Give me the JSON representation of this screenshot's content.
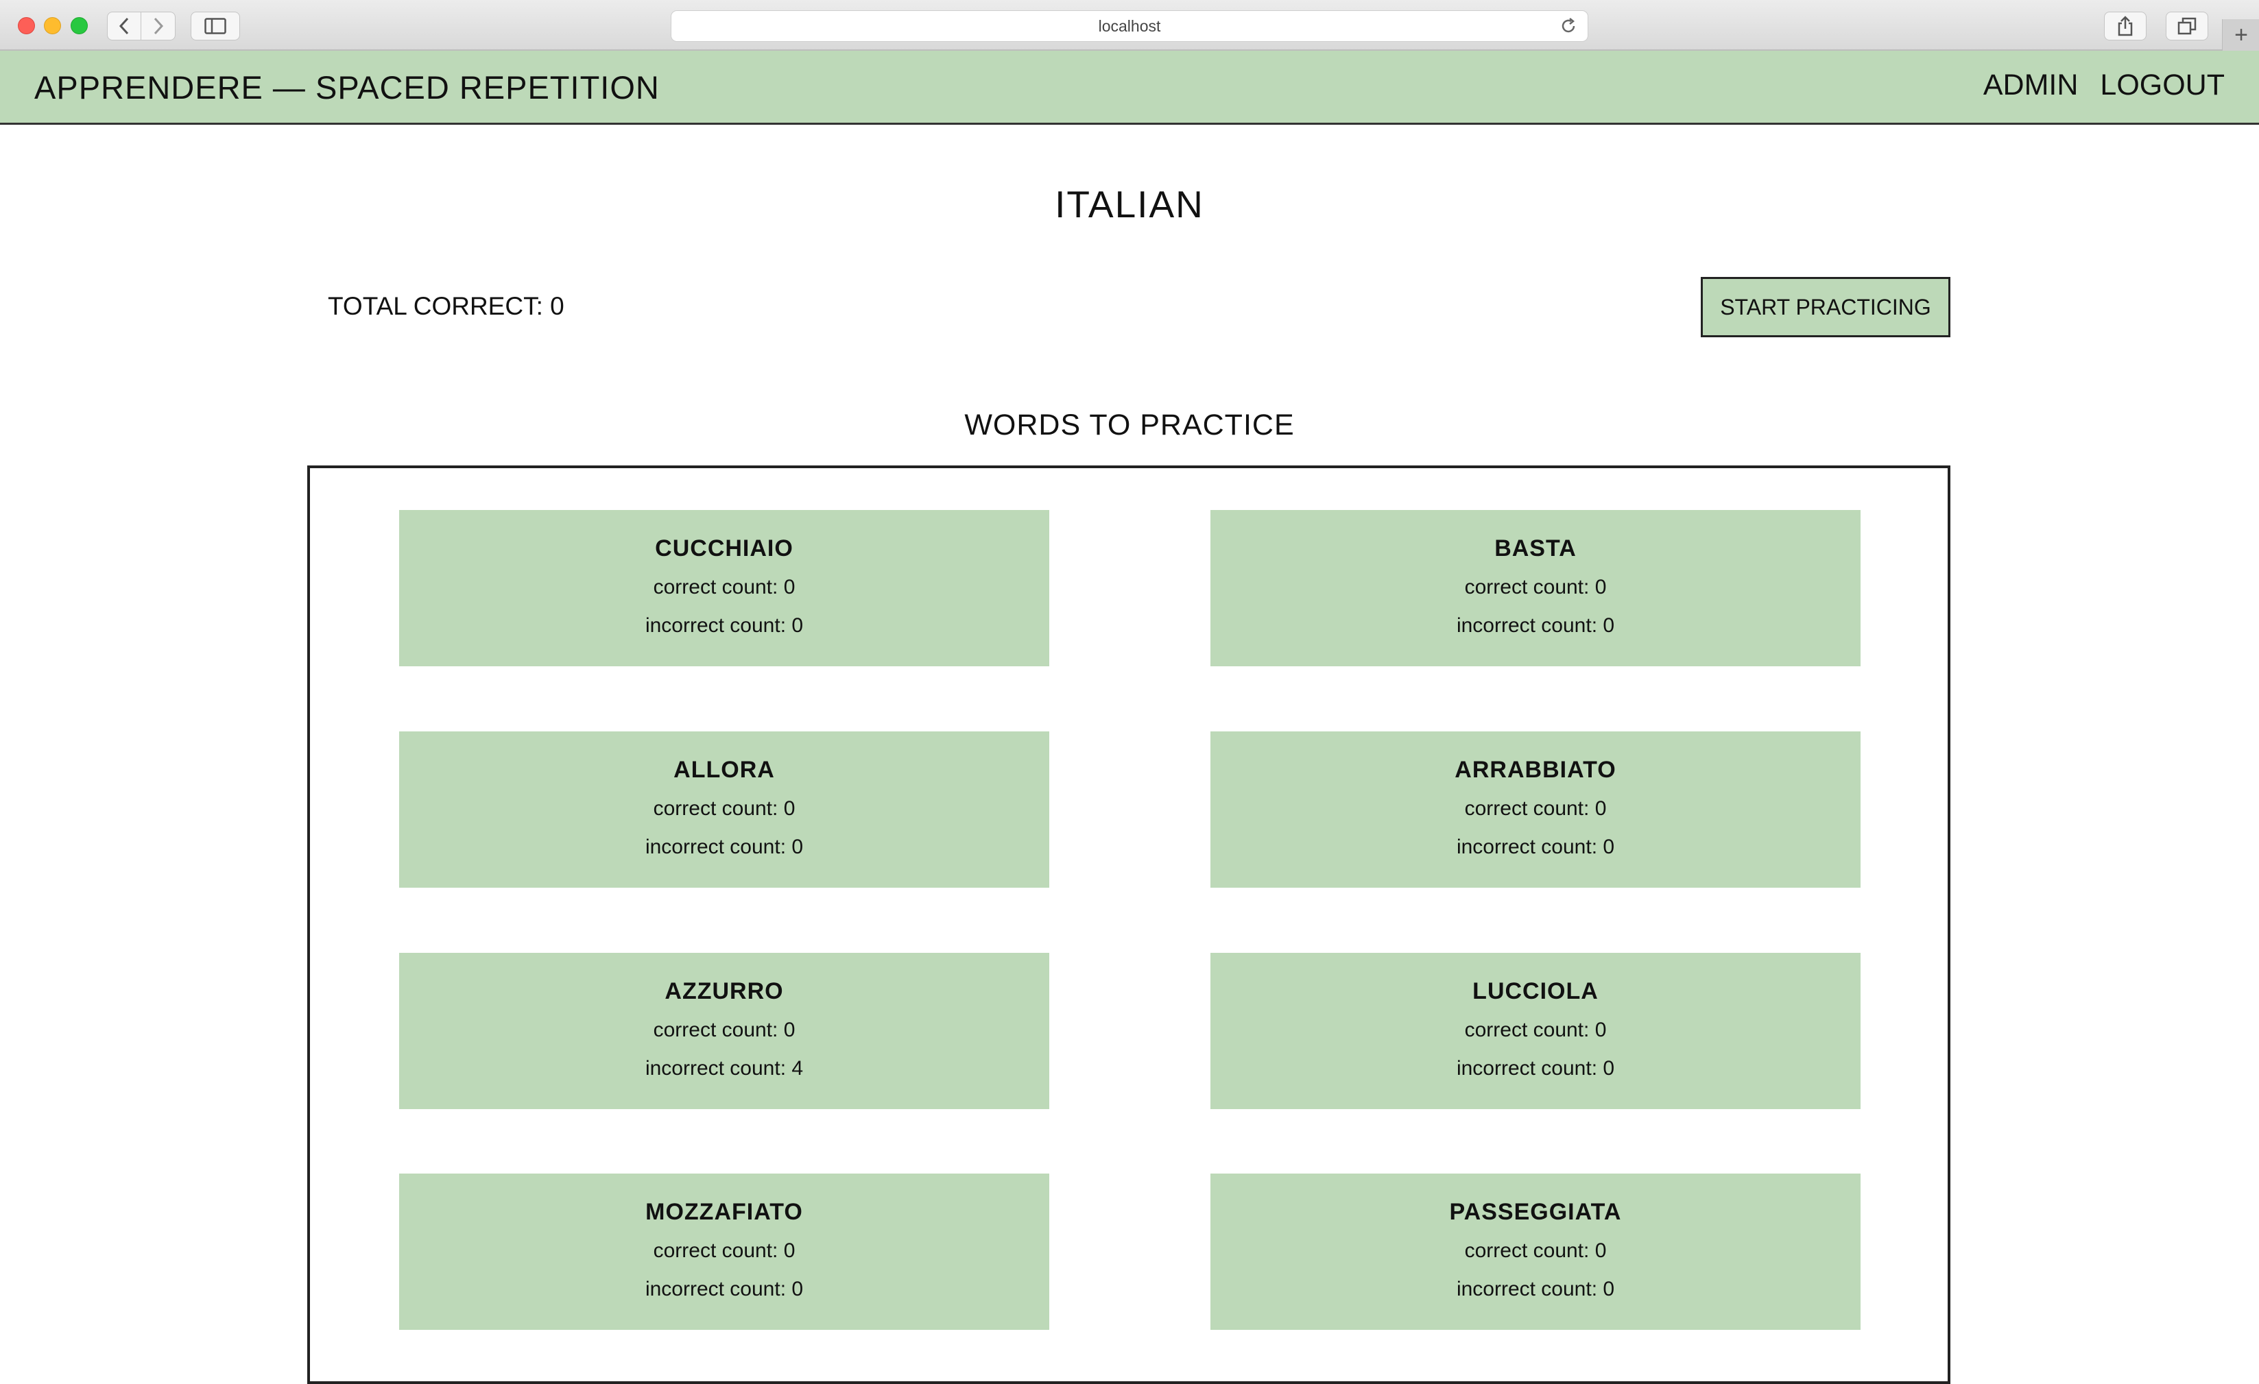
{
  "browser": {
    "url": "localhost"
  },
  "header": {
    "title": "APPRENDERE — SPACED REPETITION",
    "nav": [
      "ADMIN",
      "LOGOUT"
    ]
  },
  "language": {
    "name": "ITALIAN",
    "total_correct": "TOTAL CORRECT: 0",
    "start_button": "START PRACTICING"
  },
  "words_heading": "WORDS TO PRACTICE",
  "words": [
    {
      "word": "CUCCHIAIO",
      "correct": "correct count: 0",
      "incorrect": "incorrect count: 0"
    },
    {
      "word": "BASTA",
      "correct": "correct count: 0",
      "incorrect": "incorrect count: 0"
    },
    {
      "word": "ALLORA",
      "correct": "correct count: 0",
      "incorrect": "incorrect count: 0"
    },
    {
      "word": "ARRABBIATO",
      "correct": "correct count: 0",
      "incorrect": "incorrect count: 0"
    },
    {
      "word": "AZZURRO",
      "correct": "correct count: 0",
      "incorrect": "incorrect count: 4"
    },
    {
      "word": "LUCCIOLA",
      "correct": "correct count: 0",
      "incorrect": "incorrect count: 0"
    },
    {
      "word": "MOZZAFIATO",
      "correct": "correct count: 0",
      "incorrect": "incorrect count: 0"
    },
    {
      "word": "PASSEGGIATA",
      "correct": "correct count: 0",
      "incorrect": "incorrect count: 0"
    }
  ]
}
